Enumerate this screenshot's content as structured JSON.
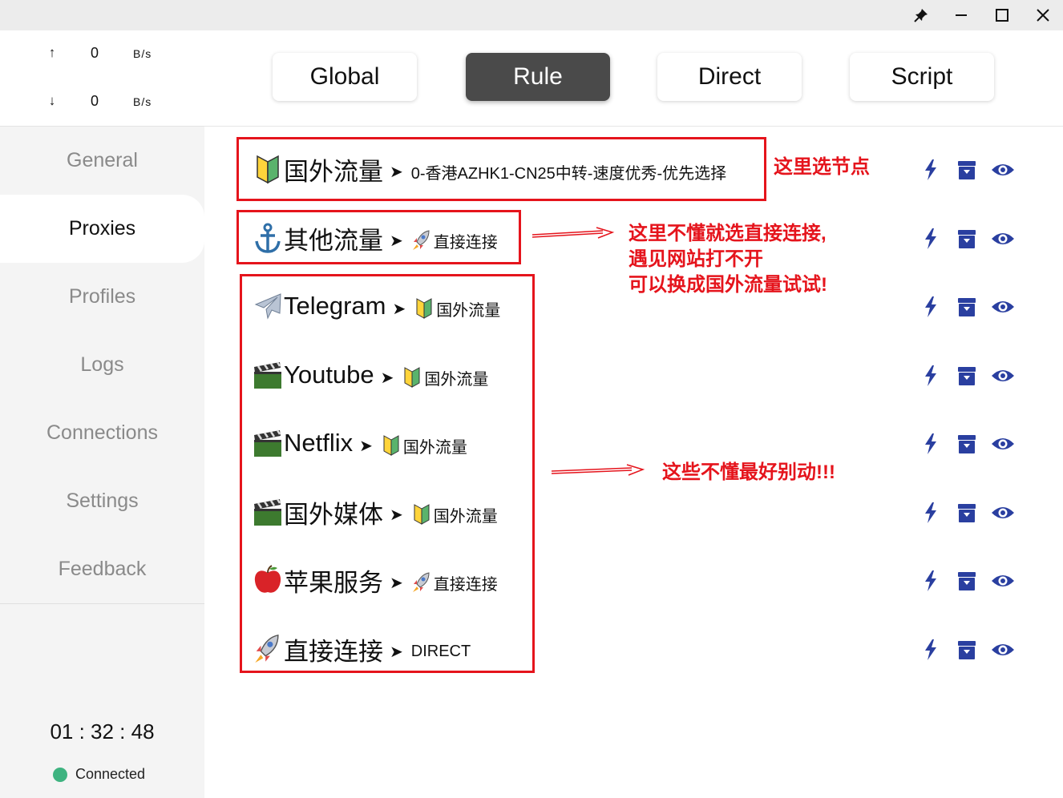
{
  "window": {
    "pin_icon": "pin-icon",
    "minimize_icon": "minimize-icon",
    "maximize_icon": "maximize-icon",
    "close_icon": "close-icon"
  },
  "traffic": {
    "upload": {
      "arrow": "↑",
      "value": "0",
      "unit": "B/s"
    },
    "download": {
      "arrow": "↓",
      "value": "0",
      "unit": "B/s"
    }
  },
  "sidebar": {
    "items": [
      {
        "label": "General"
      },
      {
        "label": "Proxies"
      },
      {
        "label": "Profiles"
      },
      {
        "label": "Logs"
      },
      {
        "label": "Connections"
      },
      {
        "label": "Settings"
      },
      {
        "label": "Feedback"
      }
    ],
    "active": "Proxies",
    "uptime": "01 : 32 : 48",
    "status": "Connected",
    "status_color": "#3eb380"
  },
  "modes": {
    "items": [
      {
        "label": "Global"
      },
      {
        "label": "Rule"
      },
      {
        "label": "Direct"
      },
      {
        "label": "Script"
      }
    ],
    "active": "Rule"
  },
  "groups": [
    {
      "icon": "beginner-shield-icon",
      "name": "国外流量",
      "separator": "➤",
      "selected_icon": "",
      "selected": "0-香港AZHK1-CN25中转-速度优秀-优先选择"
    },
    {
      "icon": "anchor-icon",
      "name": "其他流量",
      "separator": "➤",
      "selected_icon": "rocket-icon",
      "selected": "直接连接"
    },
    {
      "icon": "airplane-icon",
      "name": "Telegram",
      "separator": "➤",
      "selected_icon": "beginner-shield-icon",
      "selected": "国外流量"
    },
    {
      "icon": "clapper-icon",
      "name": "Youtube",
      "separator": "➤",
      "selected_icon": "beginner-shield-icon",
      "selected": "国外流量"
    },
    {
      "icon": "clapper-icon",
      "name": "Netflix",
      "separator": "➤",
      "selected_icon": "beginner-shield-icon",
      "selected": "国外流量"
    },
    {
      "icon": "clapper-icon",
      "name": "国外媒体",
      "separator": "➤",
      "selected_icon": "beginner-shield-icon",
      "selected": "国外流量"
    },
    {
      "icon": "apple-icon",
      "name": "苹果服务",
      "separator": "➤",
      "selected_icon": "rocket-icon",
      "selected": "直接连接"
    },
    {
      "icon": "rocket-icon",
      "name": "直接连接",
      "separator": "➤",
      "selected_icon": "",
      "selected": "DIRECT"
    }
  ],
  "row_actions": {
    "latency_icon": "lightning-icon",
    "provider_icon": "archive-icon",
    "view_icon": "eye-icon",
    "color": "#2a3fa0"
  },
  "annotations": {
    "note1": "这里选节点",
    "note2": [
      "这里不懂就选直接连接,",
      "遇见网站打不开",
      "可以换成国外流量试试!"
    ],
    "note3": "这些不懂最好别动!!!",
    "color": "#e5141c"
  }
}
